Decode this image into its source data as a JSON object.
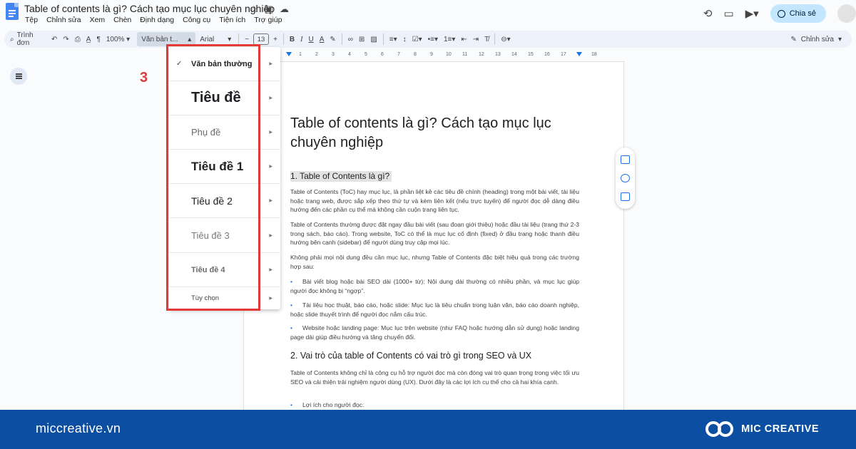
{
  "app": {
    "title": "Table of contents là gì? Cách tạo mục lục chuyên nghiệp",
    "menu": [
      "Tệp",
      "Chỉnh sửa",
      "Xem",
      "Chèn",
      "Định dạng",
      "Công cụ",
      "Tiện ích",
      "Trợ giúp"
    ],
    "share_label": "Chia sẻ"
  },
  "toolbar": {
    "menu_search": "Trình đơn",
    "zoom": "100%",
    "style": "Văn bản t...",
    "font": "Arial",
    "font_size": "13",
    "edit_mode": "Chỉnh sửa"
  },
  "ruler": [
    "1",
    "2",
    "3",
    "4",
    "5",
    "6",
    "7",
    "8",
    "9",
    "10",
    "11",
    "12",
    "13",
    "14",
    "15",
    "16",
    "17",
    "18"
  ],
  "dropdown": {
    "items": [
      {
        "label": "Văn bản thường",
        "checked": true
      },
      {
        "label": "Tiêu đề"
      },
      {
        "label": "Phụ đề"
      },
      {
        "label": "Tiêu đề 1"
      },
      {
        "label": "Tiêu đề 2"
      },
      {
        "label": "Tiêu đề 3"
      },
      {
        "label": "Tiêu đề 4"
      },
      {
        "label": "Tùy chọn"
      }
    ]
  },
  "annotation": {
    "step": "3"
  },
  "document": {
    "title": "Table of contents là gì? Cách tạo mục lục chuyên nghiệp",
    "h1": "1. Table of Contents là gì?",
    "p1": "Table of Contents (ToC) hay mục lục, là phần liệt kê các tiêu đề chính (heading) trong một bài viết, tài liệu hoặc trang web, được sắp xếp theo thứ tự và kèm liên kết (nếu trực tuyến) để người đọc dễ dàng điều hướng đến các phần cụ thể mà không cần cuộn trang liên tục.",
    "p2": "Table of Contents thường được đặt ngay đầu bài viết (sau đoạn giới thiệu) hoặc đầu tài liệu (trang thứ 2-3 trong sách, báo cáo). Trong website, ToC có thể là mục lục cố định (fixed) ở đầu trang hoặc thanh điều hướng bên cạnh (sidebar) để người dùng truy cập mọi lúc.",
    "p3": "Không phải mọi nội dung đều cần mục lục, nhưng Table of Contents đặc biệt hiệu quả trong các trường hợp sau:",
    "bullets": [
      "Bài viết blog hoặc bài SEO dài (1000+ từ): Nội dung dài thường có nhiều phần, và mục lục giúp người đọc không bị “ngợp”.",
      "Tài liệu học thuật, báo cáo, hoặc slide: Mục lục là tiêu chuẩn trong luận văn, báo cáo doanh nghiệp, hoặc slide thuyết trình để người đọc nắm cấu trúc.",
      "Website hoặc landing page: Mục lục trên website (như FAQ hoặc hướng dẫn sử dụng) hoặc landing page dài giúp điều hướng và tăng chuyển đổi."
    ],
    "h2": "2. Vai trò của table of Contents có vai trò gì trong SEO và UX",
    "p4": "Table of Contents không chỉ là công cụ hỗ trợ người đọc mà còn đóng vai trò quan trọng trong việc tối ưu SEO và cải thiện trải nghiệm người dùng (UX). Dưới đây là các lợi ích cụ thể cho cả hai khía cạnh.",
    "last_bullet": "Lợi ích cho người đọc:"
  },
  "footer": {
    "site": "miccreative.vn",
    "brand": "MIC CREATIVE"
  }
}
